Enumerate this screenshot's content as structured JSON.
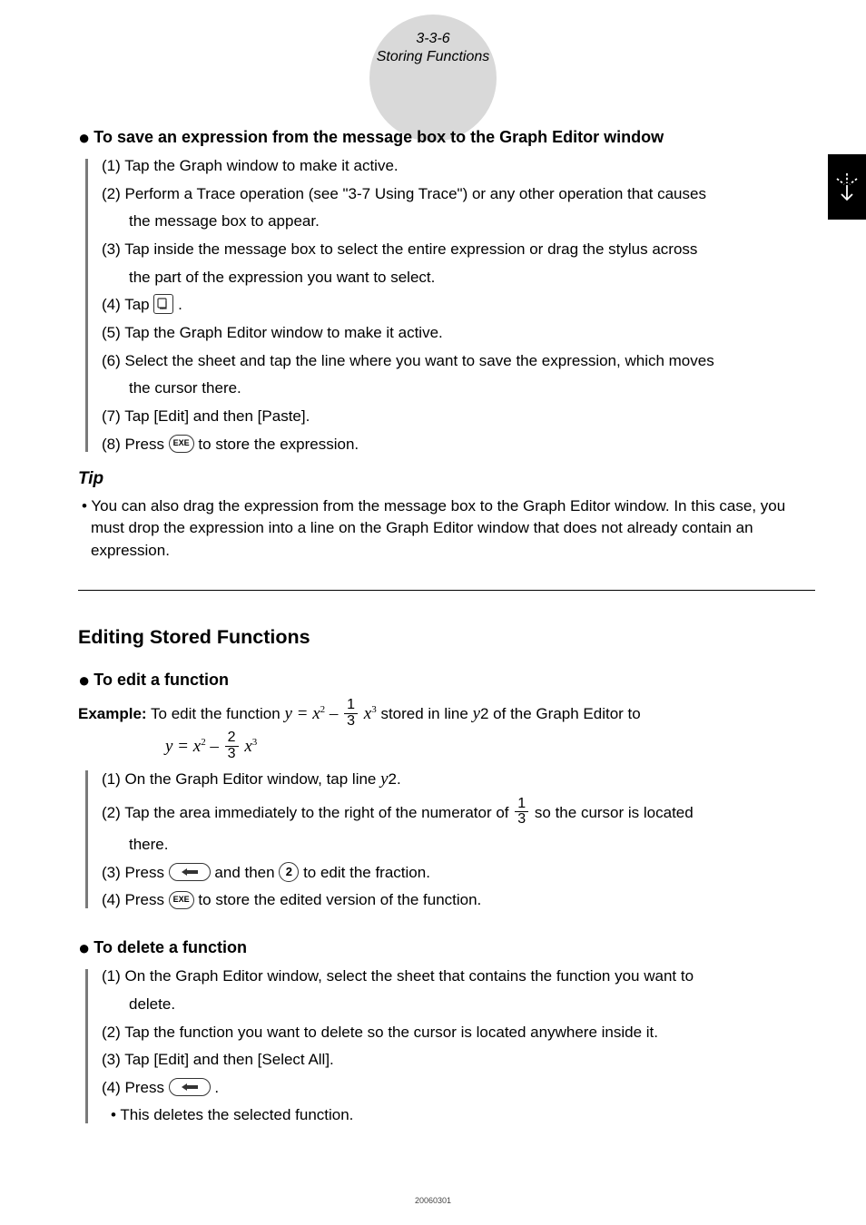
{
  "page": {
    "number": "3-3-6",
    "title": "Storing Functions"
  },
  "sec1": {
    "heading": "To save an expression from the message box to the Graph Editor window",
    "s1": "(1) Tap the Graph window to make it active.",
    "s2a": "(2) Perform a Trace operation (see \"3-7 Using Trace\") or any other operation that causes",
    "s2b": "the message box to appear.",
    "s3a": "(3) Tap inside the message box to select the entire expression or drag the stylus across",
    "s3b": "the part of the expression you want to select.",
    "s4a": "(4) Tap ",
    "s4b": ".",
    "s5": "(5) Tap the Graph Editor window to make it active.",
    "s6a": "(6) Select the sheet and tap the line where you want to save the expression, which moves",
    "s6b": "the cursor there.",
    "s7": "(7) Tap [Edit] and then [Paste].",
    "s8a": "(8) Press ",
    "s8b": " to store the expression."
  },
  "tip": {
    "head": "Tip",
    "body": "• You can also drag the expression from the message box to the Graph Editor window. In this case, you must drop the expression into a line on the Graph Editor window that does not already contain an expression."
  },
  "sec2": {
    "heading": "Editing Stored Functions"
  },
  "edit": {
    "heading": "To edit a function",
    "ex_label": "Example:",
    "ex_a": "  To edit the function ",
    "ex_b": " stored in line ",
    "ex_c": "2 of the Graph Editor to",
    "eq1": {
      "yeq": "y = x",
      "minus": " – ",
      "num": "1",
      "den": "3",
      "x3": "x"
    },
    "eq2": {
      "yeq": "y = x",
      "minus": " – ",
      "num": "2",
      "den": "3",
      "x3": "x"
    },
    "s1a": "(1) On the Graph Editor window, tap line ",
    "s1b": "2.",
    "s2a": "(2) Tap the area immediately to the right of the numerator of ",
    "s2b": " so the cursor is located",
    "s2c": "there.",
    "s3a": "(3) Press ",
    "s3b": " and then ",
    "s3c": " to edit the fraction.",
    "s4a": "(4) Press ",
    "s4b": " to store the edited version of the function."
  },
  "del": {
    "heading": "To delete a function",
    "s1a": "(1) On the Graph Editor window, select the sheet that contains the function you want to",
    "s1b": "delete.",
    "s2": "(2) Tap the function you want to delete so the cursor is located anywhere inside it.",
    "s3": "(3) Tap [Edit] and then [Select All].",
    "s4a": "(4) Press ",
    "s4b": ".",
    "s5": "• This deletes the selected function."
  },
  "keys": {
    "exe": "EXE",
    "two": "2"
  },
  "frac13": {
    "n": "1",
    "d": "3"
  },
  "footer": "20060301"
}
